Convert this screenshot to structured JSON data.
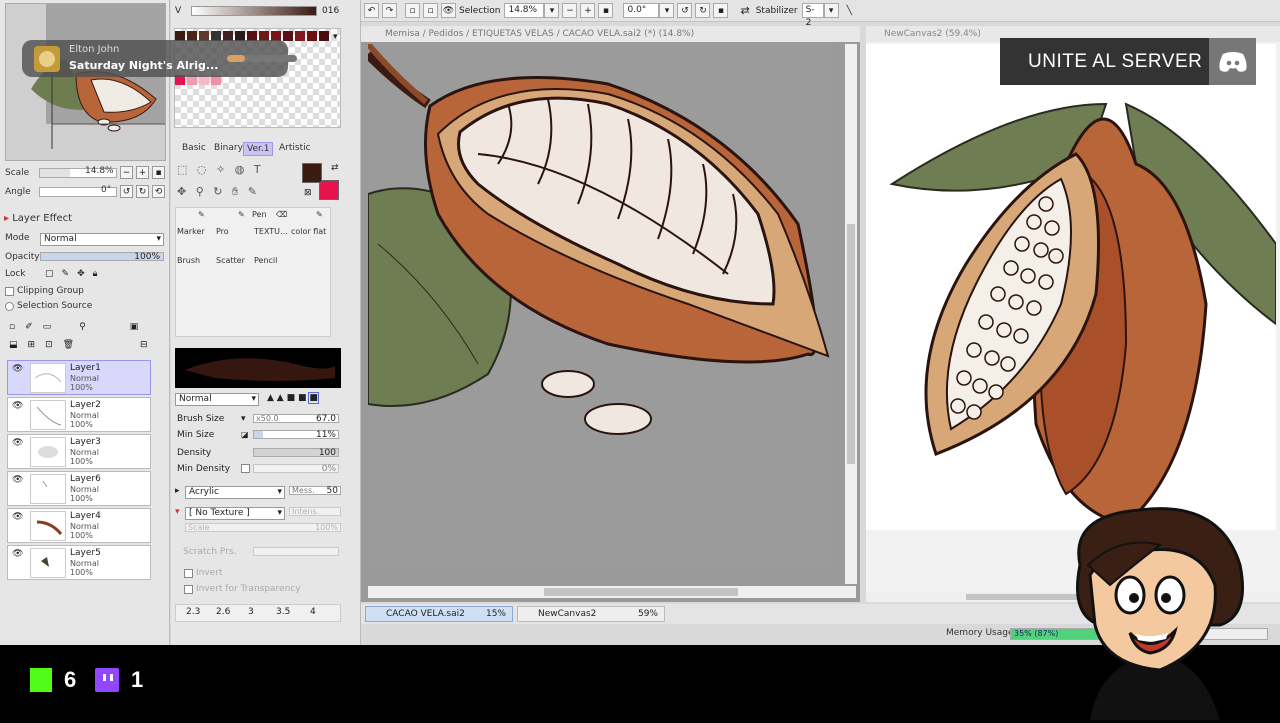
{
  "notification": {
    "artist": "Elton John",
    "title": "Saturday Night's Alrig...",
    "progress": 0.25
  },
  "color_panel": {
    "label_v": "V",
    "value_v": "016"
  },
  "navigator": {
    "scale_label": "Scale",
    "scale_value": "14.8%",
    "angle_label": "Angle",
    "angle_value": "0°"
  },
  "layer_effect": {
    "title": "Layer Effect",
    "mode_label": "Mode",
    "mode_value": "Normal",
    "opacity_label": "Opacity",
    "opacity_value": "100%",
    "lock_label": "Lock",
    "clipping_group": "Clipping Group",
    "selection_source": "Selection Source"
  },
  "layers": [
    {
      "name": "Layer1",
      "mode": "Normal",
      "opacity": "100%",
      "selected": true
    },
    {
      "name": "Layer2",
      "mode": "Normal",
      "opacity": "100%",
      "selected": false
    },
    {
      "name": "Layer3",
      "mode": "Normal",
      "opacity": "100%",
      "selected": false
    },
    {
      "name": "Layer6",
      "mode": "Normal",
      "opacity": "100%",
      "selected": false
    },
    {
      "name": "Layer4",
      "mode": "Normal",
      "opacity": "100%",
      "selected": false
    },
    {
      "name": "Layer5",
      "mode": "Normal",
      "opacity": "100%",
      "selected": false
    }
  ],
  "tool_tabs": [
    "Basic",
    "Binary",
    "Ver.1",
    "Artistic"
  ],
  "active_tool_tab": "Ver.1",
  "brushes": {
    "pen": "Pen",
    "marker": "Marker",
    "pro": "Pro",
    "textu": "TEXTU...",
    "color_flat": "color flat",
    "brush": "Brush",
    "scatter": "Scatter",
    "pencil": "Pencil"
  },
  "brush_settings": {
    "blend_mode": "Normal",
    "brush_size_label": "Brush Size",
    "brush_size_mult": "x50.0",
    "brush_size_value": "67.0",
    "min_size_label": "Min Size",
    "min_size_value": "11%",
    "density_label": "Density",
    "density_value": "100",
    "min_density_label": "Min Density",
    "min_density_value": "0%",
    "shape": "Acrylic",
    "mess_label": "Mess.",
    "mess_value": "50",
    "texture": "[ No Texture ]",
    "intens_label": "Intens.",
    "scale_label": "Scale",
    "scale_value": "100%",
    "scratch_label": "Scratch Prs.",
    "invert": "Invert",
    "invert_transparency": "Invert for Transparency",
    "size_presets": [
      "2.3",
      "2.6",
      "3",
      "3.5",
      "4"
    ]
  },
  "toolbar": {
    "selection_label": "Selection",
    "zoom_value": "14.8%",
    "angle_value": "0.0°",
    "stabilizer_label": "Stabilizer",
    "stabilizer_value": "S-2"
  },
  "canvas_main": {
    "title": "Memisa / Pedidos / ETIQUETAS VELAS / CACAO VELA.sai2 (*) (14.8%)"
  },
  "canvas_second": {
    "title": "NewCanvas2 (59.4%)"
  },
  "doc_tabs": [
    {
      "name": "CACAO VELA.sai2",
      "pct": "15%",
      "active": true
    },
    {
      "name": "NewCanvas2",
      "pct": "59%",
      "active": false
    }
  ],
  "memory": {
    "label": "Memory Usage",
    "value": "35% (87%)",
    "fraction": 0.35
  },
  "overlay": {
    "discord_text": "UNITE AL SERVER",
    "kick_count": "6",
    "twitch_count": "1"
  },
  "colors": {
    "primary": "#3b1a12",
    "secondary": "#e8124d",
    "accent": "#c9c4f5"
  }
}
